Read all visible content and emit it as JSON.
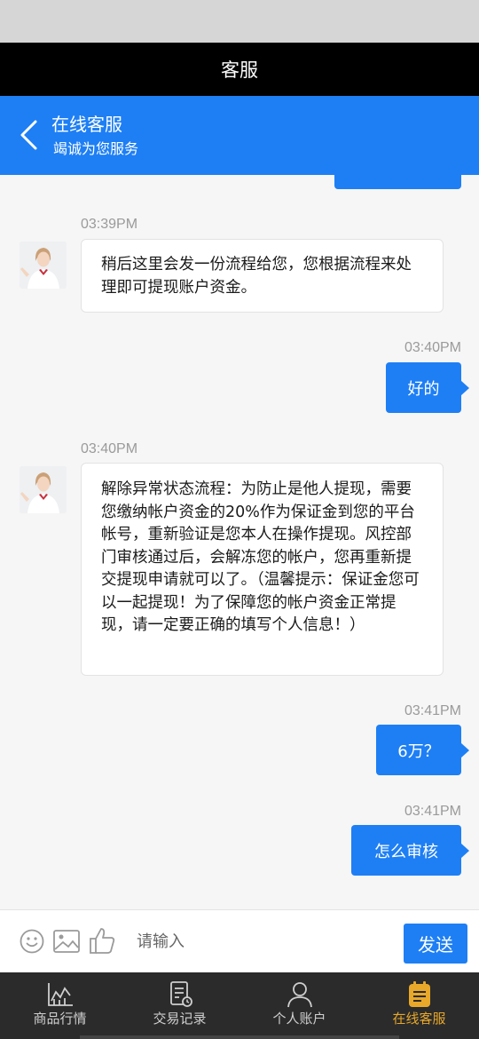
{
  "titlebar": {
    "title": "客服"
  },
  "header": {
    "title": "在线客服",
    "subtitle": "竭诚为您服务"
  },
  "messages": [
    {
      "side": "in",
      "time": "03:39PM",
      "text": "稍后这里会发一份流程给您，您根据流程来处理即可提现账户资金。"
    },
    {
      "side": "out",
      "time": "03:40PM",
      "text": "好的"
    },
    {
      "side": "in",
      "time": "03:40PM",
      "text": "解除异常状态流程：为防止是他人提现，需要您缴纳帐户资金的20%作为保证金到您的平台帐号，重新验证是您本人在操作提现。风控部门审核通过后，会解冻您的帐户，您再重新提交提现申请就可以了。（温馨提示：保证金您可以一起提现！为了保障您的帐户资金正常提现，请一定要正确的填写个人信息！）"
    },
    {
      "side": "out",
      "time": "03:41PM",
      "text": "6万？"
    },
    {
      "side": "out",
      "time": "03:41PM",
      "text": "怎么审核"
    }
  ],
  "input": {
    "placeholder": "请输入",
    "send_label": "发送"
  },
  "tabs": [
    {
      "label": "商品行情",
      "icon": "chart-icon",
      "active": false
    },
    {
      "label": "交易记录",
      "icon": "record-icon",
      "active": false
    },
    {
      "label": "个人账户",
      "icon": "user-icon",
      "active": false
    },
    {
      "label": "在线客服",
      "icon": "service-icon",
      "active": true
    }
  ],
  "colors": {
    "accent": "#1e7ff5",
    "tab_active": "#e8a82a",
    "tab_bar": "#2b2b2b"
  }
}
